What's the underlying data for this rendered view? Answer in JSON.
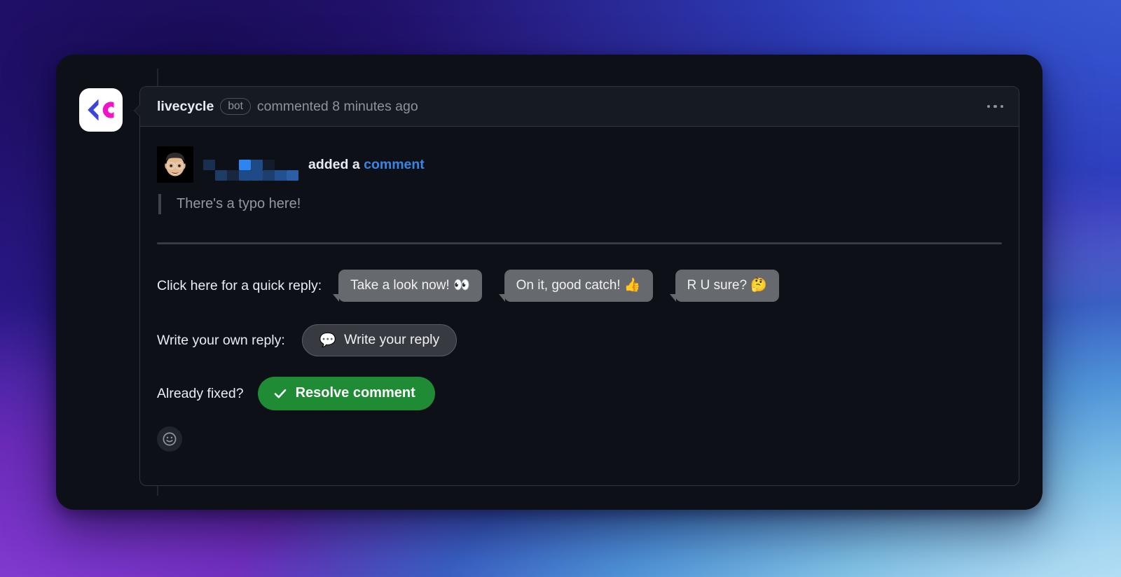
{
  "theme": {
    "page_background_top_left": "#2a1580",
    "page_background_top_right": "#2e3fbe",
    "page_background_bottom_left": "#8a44d6",
    "page_background_bottom_right": "#bfe3f7",
    "card_background": "#0d1117",
    "panel_header_background": "#161b22",
    "panel_border": "#30363d",
    "link_color": "#3984e5",
    "resolve_button_color": "#1f8b34",
    "bubble_button_color": "#66696e",
    "muted_text_color": "#8b949e"
  },
  "bot_avatar": {
    "name": "livecycle-logo",
    "chevron_color": "#3b46d8",
    "letter_color": "#f212c8",
    "background": "#ffffff"
  },
  "header": {
    "author": "livecycle",
    "badge": "bot",
    "meta": "commented 8 minutes ago",
    "menu_icon": "kebab-menu-icon"
  },
  "quoted_comment": {
    "avatar_icon": "memoji-avatar",
    "author_redacted": true,
    "action_text": "added a",
    "action_link": "comment",
    "quote": "There's a typo here!"
  },
  "actions": {
    "quick_reply": {
      "label": "Click here for a quick reply:",
      "buttons": [
        {
          "text": "Take a look now!",
          "emoji": "👀",
          "name": "quick-reply-take-a-look"
        },
        {
          "text": "On it, good catch!",
          "emoji": "👍",
          "name": "quick-reply-on-it"
        },
        {
          "text": "R U sure?",
          "emoji": "🤔",
          "name": "quick-reply-r-u-sure"
        }
      ]
    },
    "write_reply": {
      "label": "Write your own reply:",
      "button_text": "Write your reply",
      "button_emoji": "💬"
    },
    "resolve": {
      "label": "Already fixed?",
      "button_text": "Resolve comment",
      "button_icon": "check-icon"
    },
    "reaction": {
      "icon": "smiley-face-icon"
    }
  }
}
